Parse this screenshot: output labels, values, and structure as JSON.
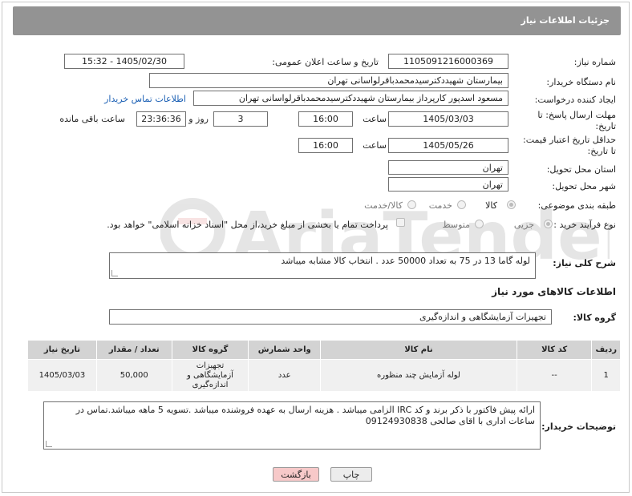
{
  "header": {
    "title": "جزئیات اطلاعات نیاز"
  },
  "fields": {
    "need_number_label": "شماره نیاز:",
    "need_number": "1105091216000369",
    "announce_label": "تاریخ و ساعت اعلان عمومی:",
    "announce_value": "1405/02/30 - 15:32",
    "buyer_org_label": "نام دستگاه خریدار:",
    "buyer_org": "بیمارستان شهیددکترسیدمحمدباقرلواسانی تهران",
    "creator_label": "ایجاد کننده درخواست:",
    "creator": "مسعود اسدپور کارپرداز بیمارستان شهیددکترسیدمحمدباقرلواسانی تهران",
    "contact_link": "اطلاعات تماس خریدار",
    "reply_deadline_label_1": "مهلت ارسال پاسخ: تا",
    "reply_deadline_label_2": "تاریخ:",
    "reply_date": "1405/03/03",
    "time_label": "ساعت",
    "reply_time": "16:00",
    "days_value": "3",
    "days_label": "روز و",
    "remaining_time": "23:36:36",
    "remaining_label": "ساعت باقی مانده",
    "price_deadline_label_1": "حداقل تاریخ اعتبار قیمت:",
    "price_deadline_label_2": "تا تاریخ:",
    "price_date": "1405/05/26",
    "price_time": "16:00",
    "province_label": "استان محل تحویل:",
    "province": "تهران",
    "city_label": "شهر محل تحویل:",
    "city": "تهران",
    "category_label": "طبقه بندی موضوعی:",
    "category_options": [
      "کالا",
      "خدمت",
      "کالا/خدمت"
    ],
    "process_label": "نوع فرآیند خرید :",
    "process_options": [
      "جزیی",
      "متوسط"
    ],
    "payment_note": "پرداخت تمام یا بخشی از مبلغ خرید،از محل \"اسناد خزانه اسلامی\" خواهد بود.",
    "description_label": "شرح کلی نیاز:",
    "description": "لوله گاما 13 در 75 به تعداد 50000 عدد . انتخاب کالا مشابه میباشد",
    "goods_info_title": "اطلاعات کالاهای مورد نیاز",
    "goods_group_label": "گروه کالا:",
    "goods_group": "تجهیزات آزمایشگاهی و اندازه‌گیری",
    "buyer_notes_label": "توضیحات خریدار:",
    "buyer_notes": "ارائه پیش فاکتور با ذکر برند و کد IRC الزامی میباشد . هزینه ارسال به عهده فروشنده میباشد .تسویه 5 ماهه میباشد.تماس در ساعات اداری با اقای صالحی 09124930838"
  },
  "table": {
    "headers": [
      "ردیف",
      "کد کالا",
      "نام کالا",
      "واحد شمارش",
      "گروه کالا",
      "تعداد / مقدار",
      "تاریخ نیاز"
    ],
    "rows": [
      [
        "1",
        "--",
        "لوله آزمایش چند منظوره",
        "عدد",
        "تجهیزات آزمایشگاهی و اندازه‌گیری",
        "50,000",
        "1405/03/03"
      ]
    ]
  },
  "buttons": {
    "print": "چاپ",
    "back": "بازگشت"
  },
  "colors": {
    "header_bg": "#939393",
    "back_btn": "#f7c9c9",
    "print_btn": "#ececec",
    "link": "#1a5fb4"
  }
}
